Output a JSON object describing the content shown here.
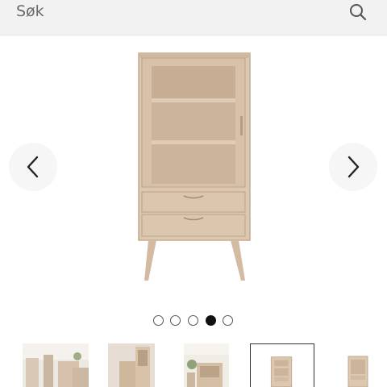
{
  "search": {
    "placeholder": "Søk",
    "icon": "search-icon"
  },
  "gallery": {
    "image_count": 5,
    "active_index": 3,
    "prev_icon": "chevron-left-icon",
    "next_icon": "chevron-right-icon",
    "thumbnails_visible": 5,
    "selected_thumbnail": 3
  },
  "colors": {
    "wood": "#d9c4ad",
    "wood_dark": "#c6ae95",
    "interior": "#c9b49e",
    "nav_bg": "#f6f6f6",
    "dot_active": "#111111"
  }
}
